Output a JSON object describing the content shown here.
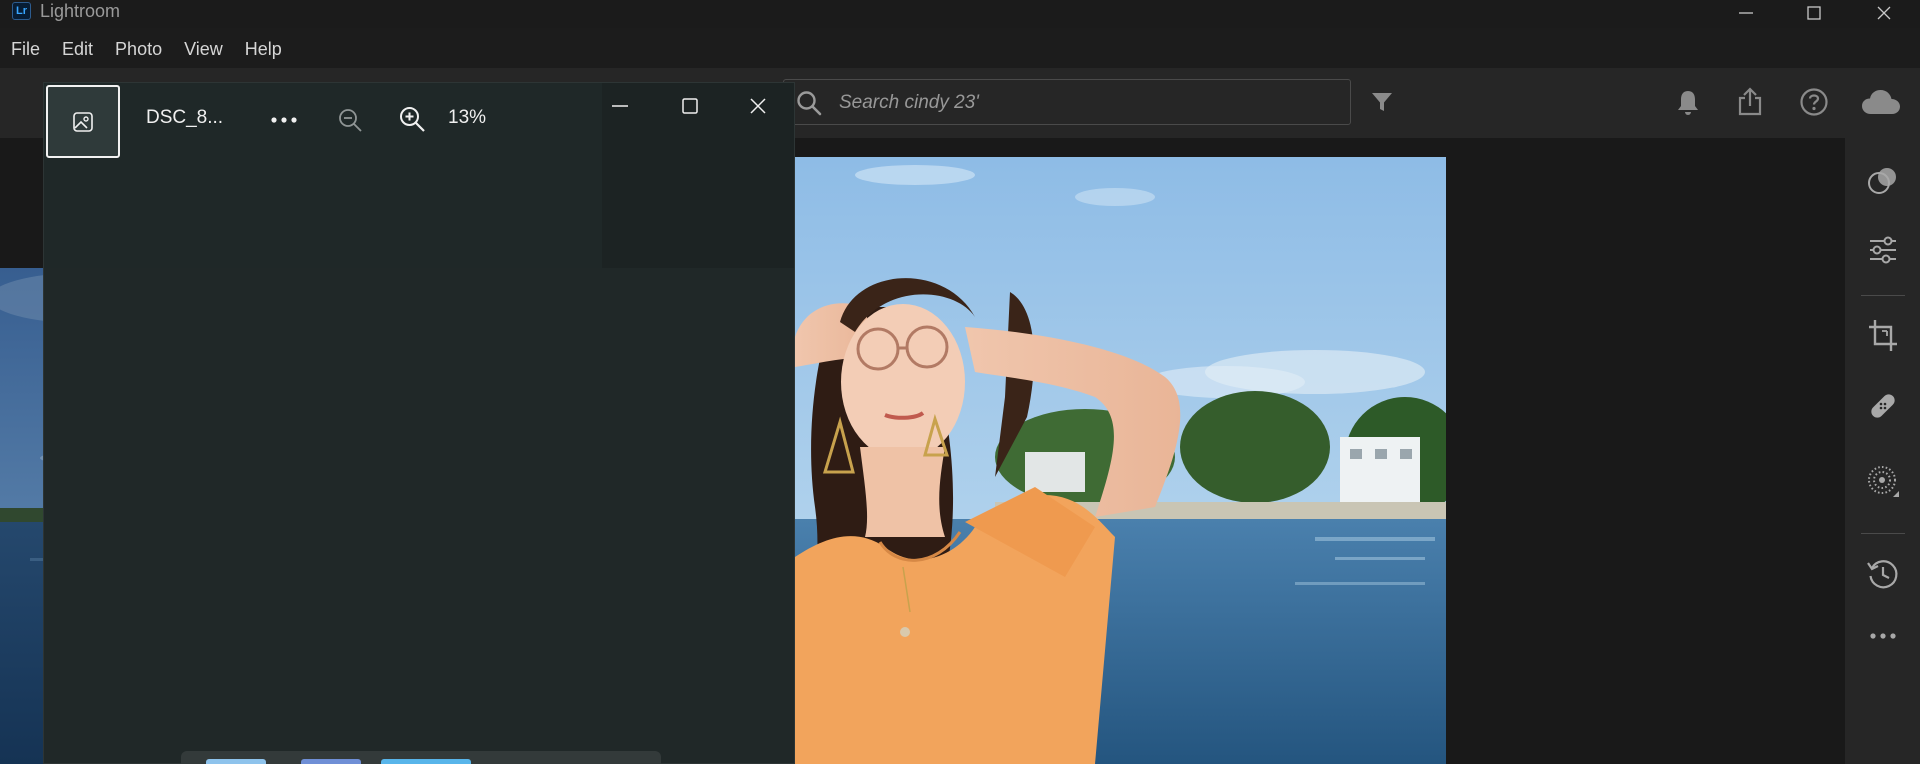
{
  "app": {
    "logo_text": "Lr",
    "title": "Lightroom"
  },
  "menu": [
    "File",
    "Edit",
    "Photo",
    "View",
    "Help"
  ],
  "search": {
    "placeholder": "Search cindy 23'",
    "value": ""
  },
  "viewer": {
    "filename": "DSC_8...",
    "zoom": "13%"
  },
  "colors": {
    "accent": "#38a6ff",
    "background": "#1c1c1c",
    "toolbar": "#262626",
    "viewer_bg": "#202828"
  },
  "icons": {
    "titlebar": [
      "minimize-icon",
      "maximize-icon",
      "close-icon"
    ],
    "toolbar": [
      "search-icon",
      "filter-icon",
      "bell-icon",
      "share-icon",
      "help-icon",
      "cloud-icon"
    ],
    "sidebar": [
      "edit-presets-icon",
      "edit-sliders-icon",
      "crop-icon",
      "healing-icon",
      "masking-icon",
      "history-icon",
      "more-icon"
    ],
    "viewer": [
      "gallery-icon",
      "more-icon",
      "zoom-out-icon",
      "zoom-in-icon",
      "minimize-icon",
      "maximize-icon",
      "close-icon"
    ]
  }
}
